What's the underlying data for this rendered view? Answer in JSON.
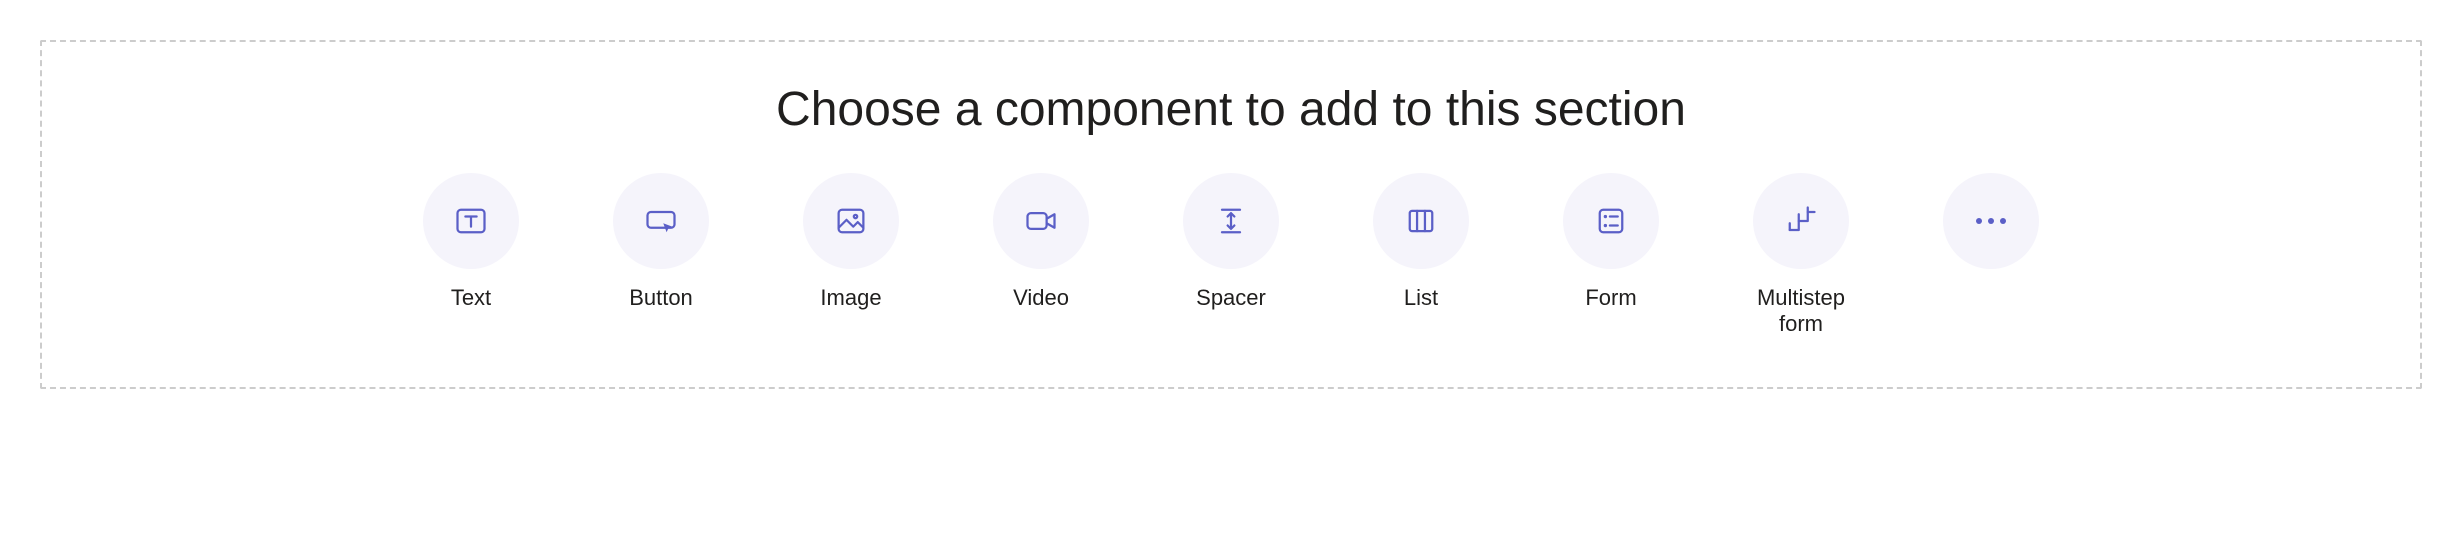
{
  "heading": "Choose a component to add to this section",
  "components": {
    "text": {
      "label": "Text"
    },
    "button": {
      "label": "Button"
    },
    "image": {
      "label": "Image"
    },
    "video": {
      "label": "Video"
    },
    "spacer": {
      "label": "Spacer"
    },
    "list": {
      "label": "List"
    },
    "form": {
      "label": "Form"
    },
    "multistep": {
      "label": "Multistep form"
    }
  },
  "colors": {
    "icon_bg": "#f5f4fb",
    "icon_fg": "#5b5fc7",
    "border": "#cccccc",
    "text": "#201f1e"
  }
}
